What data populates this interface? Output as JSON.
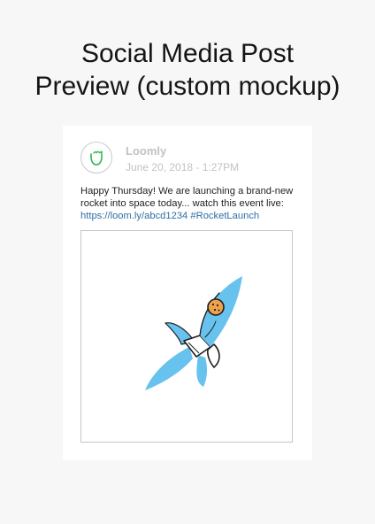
{
  "page": {
    "title_line1": "Social Media Post",
    "title_line2": "Preview (custom mockup)"
  },
  "post": {
    "account_name": "Loomly",
    "date": "June 20, 2018 - 1:27PM",
    "text_line1": "Happy Thursday! We are launching a brand-new",
    "text_line2": "rocket into space today... watch this event live:",
    "link": "https://loom.ly/abcd1234",
    "hashtag": "#RocketLaunch",
    "image_icon": "rocket-illustration",
    "avatar_icon": "loomly-logo-icon"
  },
  "colors": {
    "background": "#f6f7f6",
    "card": "#ffffff",
    "link": "#2f6fa4",
    "muted_text": "#c2c2c2",
    "logo_green": "#2fb84a",
    "rocket_blue": "#67c2ee",
    "window_orange": "#f0a24a"
  }
}
